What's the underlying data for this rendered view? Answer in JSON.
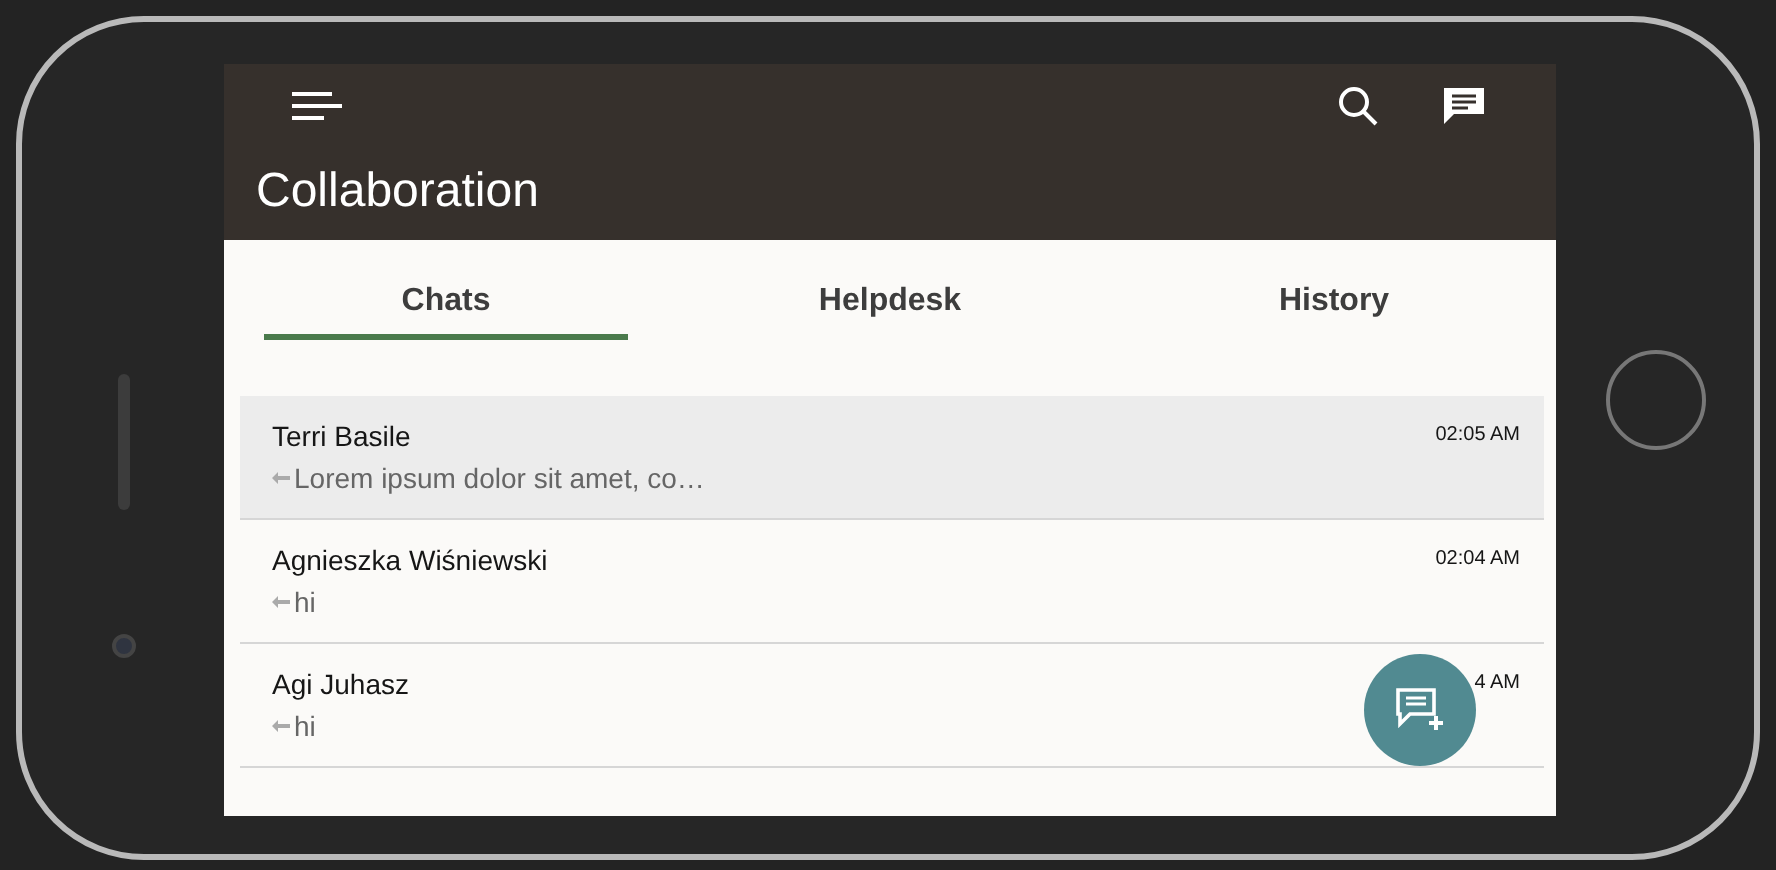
{
  "app": {
    "title": "Collaboration"
  },
  "tabs": [
    {
      "label": "Chats",
      "selected": true
    },
    {
      "label": "Helpdesk",
      "selected": false
    },
    {
      "label": "History",
      "selected": false
    }
  ],
  "chats": [
    {
      "name": "Terri Basile",
      "message": "Lorem ipsum dolor sit amet, co…",
      "time": "02:05 AM",
      "selected": true
    },
    {
      "name": "Agnieszka Wiśniewski",
      "message": "hi",
      "time": "02:04 AM",
      "selected": false
    },
    {
      "name": "Agi Juhasz",
      "message": "hi",
      "time": "4 AM",
      "selected": false
    }
  ]
}
